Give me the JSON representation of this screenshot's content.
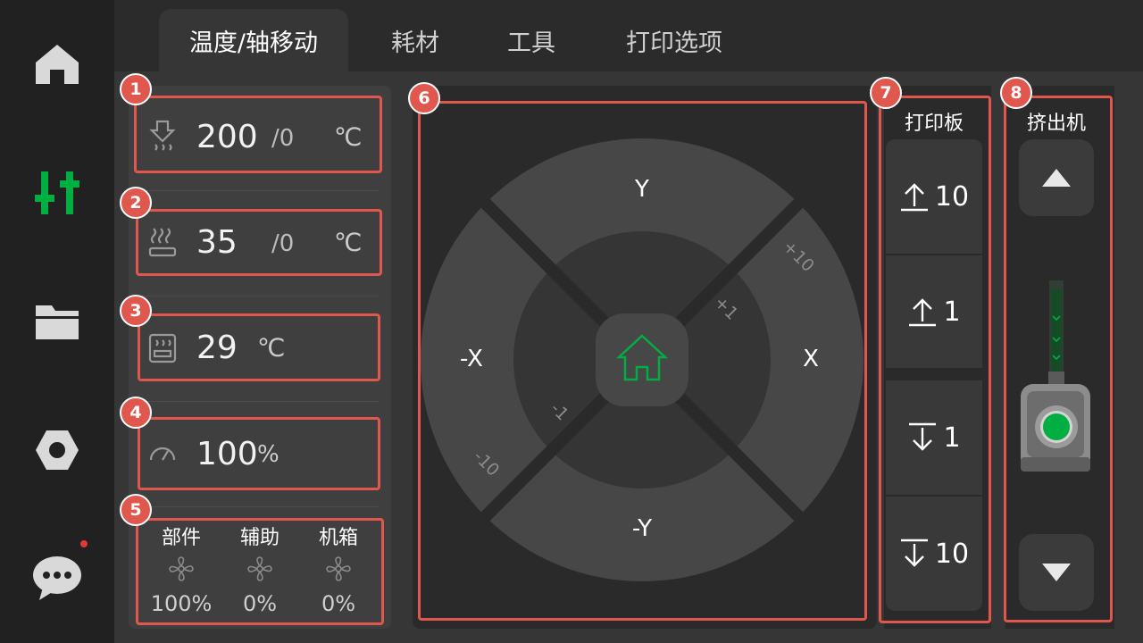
{
  "tabs": [
    "温度/轴移动",
    "耗材",
    "工具",
    "打印选项"
  ],
  "nav": {
    "items": [
      "home-icon",
      "controls-icon",
      "files-icon",
      "settings-icon",
      "messages-icon"
    ],
    "active": "controls-icon"
  },
  "badges": [
    "1",
    "2",
    "3",
    "4",
    "5",
    "6",
    "7",
    "8"
  ],
  "nozzle": {
    "current": "200",
    "target": "/0",
    "unit": "℃"
  },
  "bed": {
    "current": "35",
    "target": "/0",
    "unit": "℃"
  },
  "chamber": {
    "current": "29",
    "unit": "℃"
  },
  "speed": {
    "value": "100",
    "unit": "%"
  },
  "fans": [
    {
      "label": "部件",
      "value": "100%"
    },
    {
      "label": "辅助",
      "value": "0%"
    },
    {
      "label": "机箱",
      "value": "0%"
    }
  ],
  "jog": {
    "up": "Y",
    "down": "-Y",
    "left": "-X",
    "right": "X",
    "steps": {
      "plus10": "+10",
      "plus1": "+1",
      "minus1": "-1",
      "minus10": "-10"
    }
  },
  "bed_panel": {
    "title": "打印板",
    "buttons": [
      "10",
      "1",
      "1",
      "10"
    ]
  },
  "extruder": {
    "title": "挤出机"
  },
  "colors": {
    "accent": "#00ae42",
    "annotation": "#e0574d"
  }
}
